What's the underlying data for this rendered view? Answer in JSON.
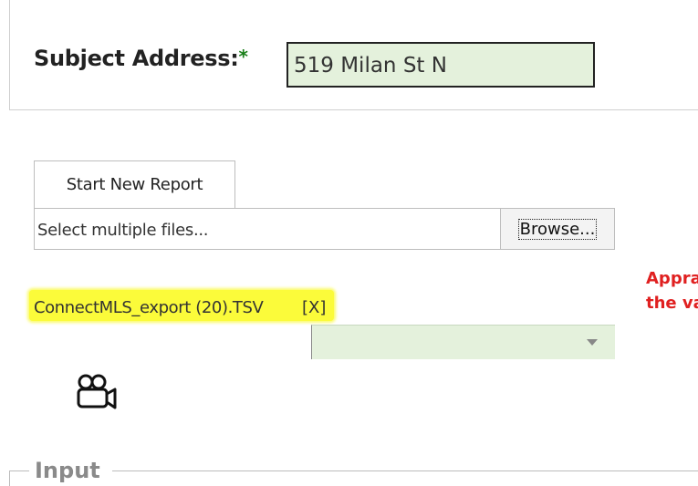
{
  "subject": {
    "label": "Subject Address:",
    "required_marker": "*",
    "value": "519 Milan St N"
  },
  "report": {
    "start_label": "Start New Report"
  },
  "upload": {
    "placeholder": "Select multiple files...",
    "browse_label": "Browse...",
    "file_name": "ConnectMLS_export (20).TSV",
    "remove_label": "[X]"
  },
  "dropdown": {
    "selected": ""
  },
  "warning": {
    "line1": "Appra",
    "line2": "the va"
  },
  "icons": {
    "video": "video-camera-icon",
    "caret": "chevron-down-icon"
  },
  "section": {
    "input_legend": "Input"
  },
  "colors": {
    "field_bg": "#e4f1dc",
    "highlight": "#fbfb3a",
    "warning": "#e02020",
    "required": "#1a7f1a"
  }
}
